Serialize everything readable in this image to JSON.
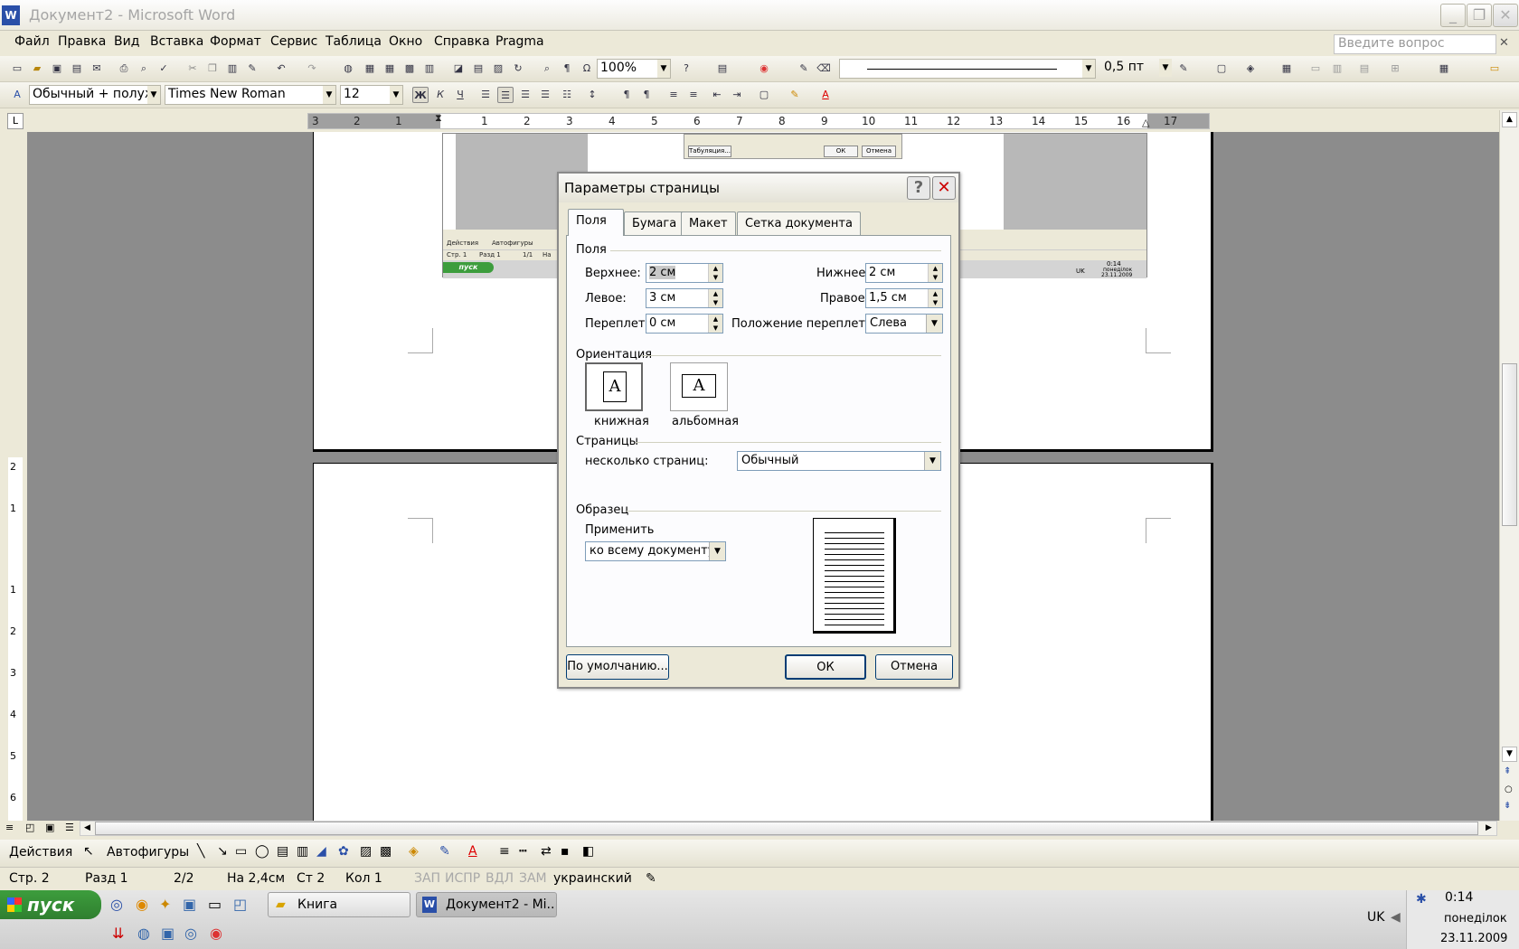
{
  "window": {
    "title": "Документ2 - Microsoft Word",
    "minimize": "_",
    "restore": "❐",
    "close": "✕"
  },
  "menu": {
    "items": [
      "Файл",
      "Правка",
      "Вид",
      "Вставка",
      "Формат",
      "Сервис",
      "Таблица",
      "Окно",
      "Справка",
      "Pragma"
    ],
    "ask_placeholder": "Введите вопрос"
  },
  "toolbar_standard": {
    "zoom": "100%",
    "line_width": "0,5 пт"
  },
  "toolbar_format": {
    "style": "Обычный + полужи",
    "font": "Times New Roman",
    "size": "12",
    "bold": "Ж",
    "italic": "К",
    "underline": "Ч"
  },
  "ruler": {
    "tab_selector": "L",
    "numbers": [
      "3",
      "2",
      "1",
      "1",
      "2",
      "3",
      "4",
      "5",
      "6",
      "7",
      "8",
      "9",
      "10",
      "11",
      "12",
      "13",
      "14",
      "15",
      "16",
      "17"
    ],
    "v_numbers": [
      "2",
      "1",
      "1",
      "2",
      "3",
      "4",
      "5",
      "6"
    ]
  },
  "thumbnail": {
    "buttons": [
      "Табуляция...",
      "ОК",
      "Отмена"
    ],
    "start": "пуск",
    "tray_time": "0:14",
    "tray_day": "понеділок",
    "tray_date": "23.11.2009",
    "tray_lang": "UK",
    "status": [
      "Стр. 1",
      "Разд 1",
      "1/1",
      "На"
    ],
    "draw": [
      "Действия",
      "Автофигуры"
    ]
  },
  "dialog": {
    "title": "Параметры страницы",
    "help": "?",
    "close": "✕",
    "tabs": [
      "Поля",
      "Бумага",
      "Макет",
      "Сетка документа"
    ],
    "margins_group": "Поля",
    "top_label": "Верхнее:",
    "top_value": "2 см",
    "bottom_label": "Нижнее:",
    "bottom_value": "2 см",
    "left_label": "Левое:",
    "left_value": "3 см",
    "right_label": "Правое:",
    "right_value": "1,5 см",
    "gutter_label": "Переплет:",
    "gutter_value": "0 см",
    "gutter_pos_label": "Положение переплета:",
    "gutter_pos_value": "Слева",
    "orientation_group": "Ориентация",
    "portrait": "книжная",
    "landscape": "альбомная",
    "orient_glyph": "A",
    "pages_group": "Страницы",
    "multiple_pages_label": "несколько страниц:",
    "multiple_pages_value": "Обычный",
    "preview_group": "Образец",
    "apply_label": "Применить",
    "apply_value": "ко всему документу",
    "default_button": "По умолчанию...",
    "ok_button": "ОК",
    "cancel_button": "Отмена"
  },
  "drawing_toolbar": {
    "actions": "Действия",
    "autoshapes": "Автофигуры"
  },
  "status": {
    "page": "Стр. 2",
    "section": "Разд 1",
    "pages": "2/2",
    "at": "На 2,4см",
    "line": "Ст 2",
    "col": "Кол 1",
    "rec": "ЗАП",
    "trk": "ИСПР",
    "ext": "ВДЛ",
    "ovr": "ЗАМ",
    "lang": "украинский"
  },
  "taskbar": {
    "start": "пуск",
    "tasks": [
      "Книга",
      "Документ2 - Mi..."
    ],
    "tray_lang": "UK",
    "time": "0:14",
    "day": "понеділок",
    "date": "23.11.2009"
  }
}
